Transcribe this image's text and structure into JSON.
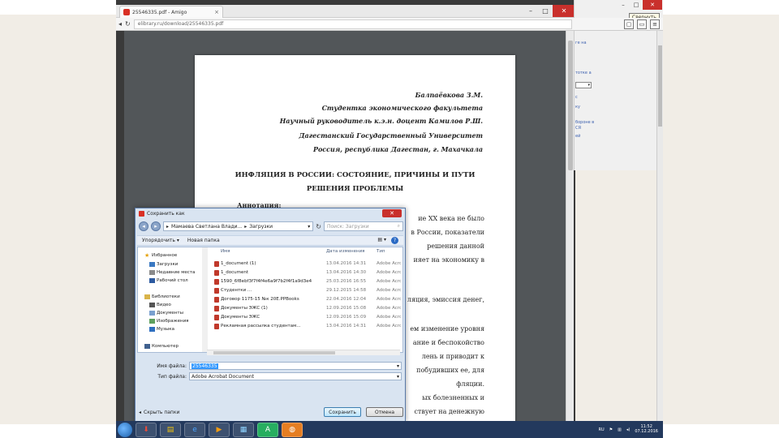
{
  "browser": {
    "tab_title": "25546335.pdf - Amigo",
    "url": "elibrary.ru/download/25546335.pdf",
    "minimize": "–",
    "maximize": "□",
    "close": "✕"
  },
  "pdf": {
    "author_lines": [
      "Балпаёвкова З.М.",
      "Студентка экономического факультета",
      "Научный руководитель к.э.н. доцент Камилов Р.Ш.",
      "Дагестанский Государственный Университет",
      "Россия, республика Дагестан, г. Махачкала"
    ],
    "title_lines": [
      "ИНФЛЯЦИЯ В РОССИИ: СОСТОЯНИЕ, ПРИЧИНЫ И ПУТИ",
      "РЕШЕНИЯ ПРОБЛЕМЫ"
    ],
    "annotation_heading": "Аннотация:",
    "visible_fragments": [
      "ие XX века не было",
      "в России, показатели",
      "решения данной",
      "ияет на экономику в",
      "ляция, эмиссия денег,",
      "ем изменение уровня",
      "ание и беспокойство",
      "лень и приводит к",
      "побудивших ее, для",
      "фляции.",
      "ых болезненных и",
      "ствует на денежную"
    ]
  },
  "side_app": {
    "tooltip": "Свернуть",
    "text_lines": [
      "ге на",
      "тотке а",
      "с",
      "ку",
      "бороне в",
      "СЯ",
      "ей"
    ],
    "select_value": "▾"
  },
  "dialog": {
    "title": "Сохранить как",
    "close": "✕",
    "breadcrumbs": [
      "Мамаева Светлана Влади...",
      "Загрузки"
    ],
    "search_placeholder": "Поиск: Загрузки",
    "organize": "Упорядочить ▾",
    "new_folder": "Новая папка",
    "help": "?",
    "tree": [
      {
        "label": "Избранное",
        "icon": "star-icon"
      },
      {
        "label": "Загрузки",
        "icon": "download-folder-icon"
      },
      {
        "label": "Недавние места",
        "icon": "recent-places-icon"
      },
      {
        "label": "Рабочий стол",
        "icon": "desktop-icon"
      },
      {
        "label": "Библиотеки",
        "icon": "library-icon"
      },
      {
        "label": "Видео",
        "icon": "video-icon"
      },
      {
        "label": "Документы",
        "icon": "documents-icon"
      },
      {
        "label": "Изображения",
        "icon": "images-icon"
      },
      {
        "label": "Музыка",
        "icon": "music-icon"
      },
      {
        "label": "Компьютер",
        "icon": "computer-icon"
      }
    ],
    "columns": [
      "Имя",
      "Дата изменения",
      "Тип"
    ],
    "files": [
      {
        "name": "1_document (1)",
        "date": "13.04.2016 14:31",
        "type": "Adobe Acrobat"
      },
      {
        "name": "1_document",
        "date": "13.04.2016 14:30",
        "type": "Adobe Acrobat"
      },
      {
        "name": "1590_6f8ebf3f7f4f4e6a9f7b2f4f1a9d3e4",
        "date": "25.03.2016 16:55",
        "type": "Adobe Acrobat"
      },
      {
        "name": "Студентки ...",
        "date": "29.12.2015 14:58",
        "type": "Adobe Acrobat"
      },
      {
        "name": "Договор 1175-15 №к 20Е.PPBooks",
        "date": "22.04.2016 12:04",
        "type": "Adobe Acrobat"
      },
      {
        "name": "Документы ЭЖС (1)",
        "date": "12.09.2016 15:08",
        "type": "Adobe Acrobat"
      },
      {
        "name": "Документы ЭЖС",
        "date": "12.09.2016 15:09",
        "type": "Adobe Acrobat"
      },
      {
        "name": "Рекламная рассылка студентам...",
        "date": "13.04.2016 14:31",
        "type": "Adobe Acrobat"
      }
    ],
    "filename_label": "Имя файла:",
    "filename_value": "25546335",
    "filetype_label": "Тип файла:",
    "filetype_value": "Adobe Acrobat Document",
    "hide_folders": "Скрыть папки",
    "save": "Сохранить",
    "cancel": "Отмена"
  },
  "taskbar": {
    "lang": "RU",
    "time": "11:52",
    "date": "07.12.2016"
  }
}
